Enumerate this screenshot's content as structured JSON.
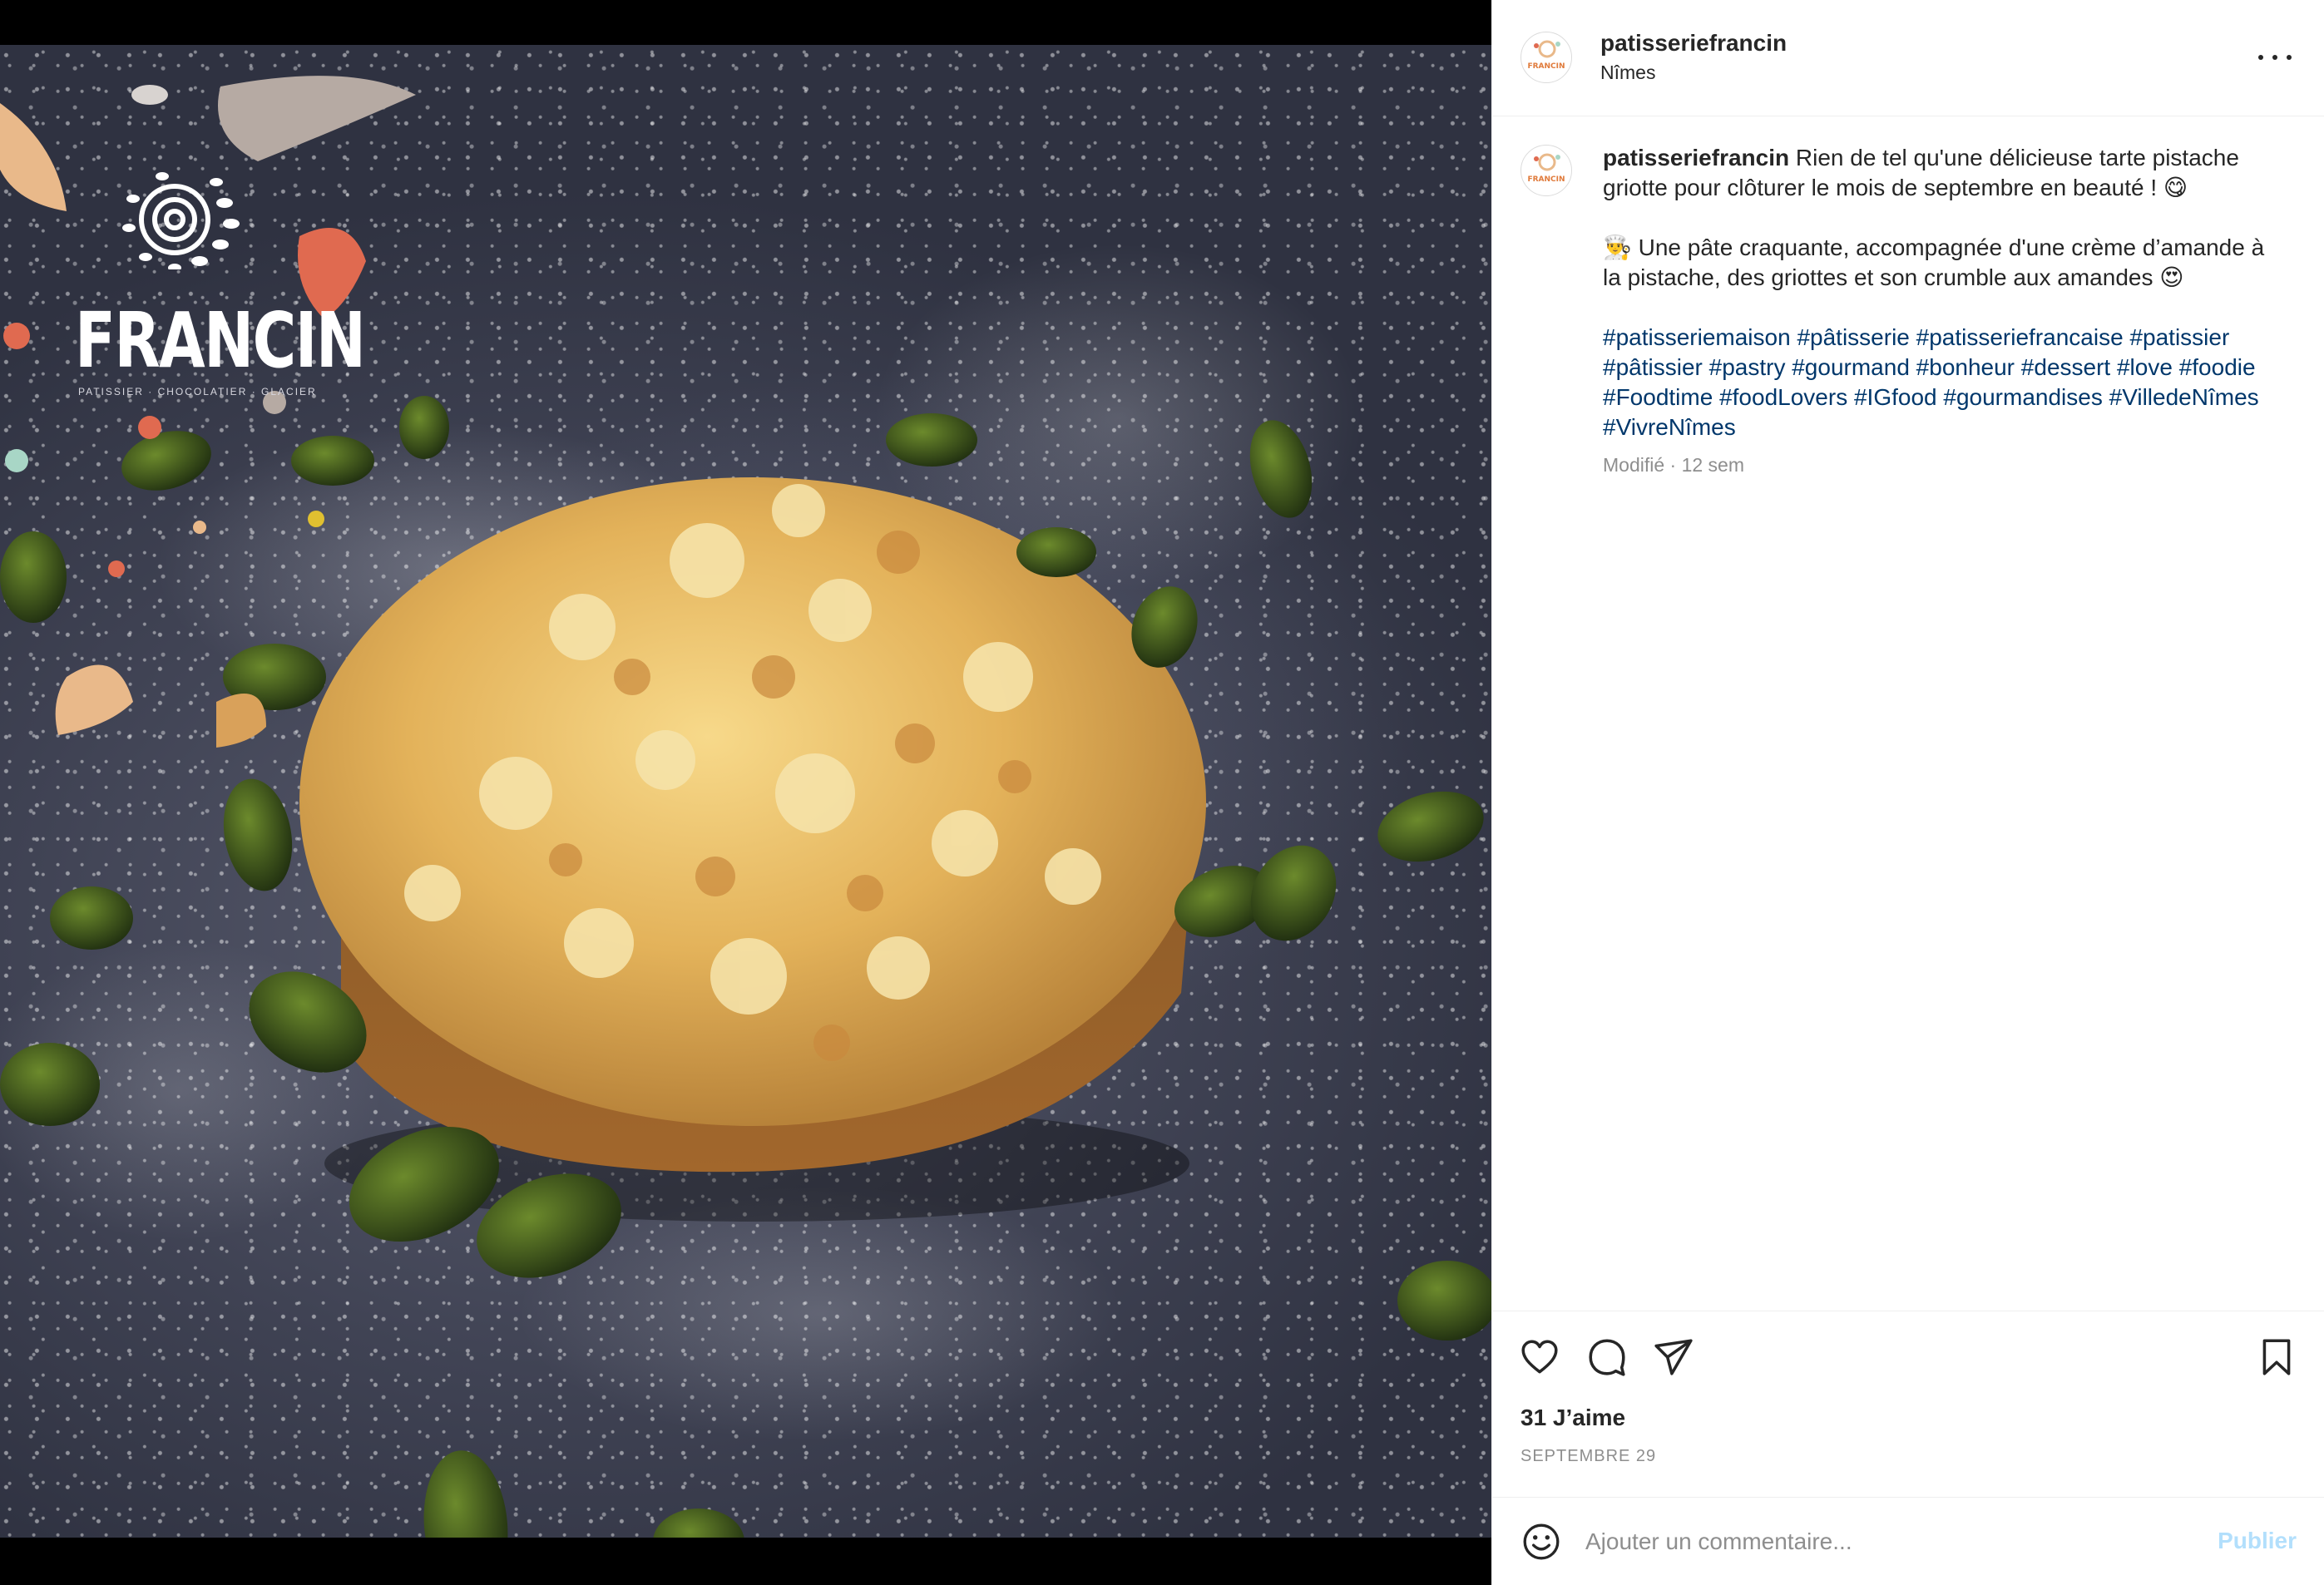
{
  "post": {
    "username": "patisseriefrancin",
    "location": "Nîmes",
    "avatar_text": "FRANCIN",
    "image": {
      "logo_word": "FRANCIN",
      "logo_subtitle": "PATISSIER · CHOCOLATIER · GLACIER",
      "alt": "Tarte pistache griotte avec crumble"
    }
  },
  "caption": {
    "username": "patisseriefrancin",
    "line1": "Rien de tel qu'une délicieuse tarte pistache griotte pour clôturer le mois de septembre en beauté ! 😋",
    "line2": "👨‍🍳 Une pâte craquante, accompagnée d'une crème d’amande à la pistache, des griottes et son crumble aux amandes 😍",
    "hashtags": [
      "#patisseriemaison",
      "#pâtisserie",
      "#patisseriefrancaise",
      "#patissier",
      "#pâtissier",
      "#pastry",
      "#gourmand",
      "#bonheur",
      "#dessert",
      "#love",
      "#foodie",
      "#Foodtime",
      "#foodLovers",
      "#IGfood",
      "#gourmandises",
      "#VilledeNîmes",
      "#VivreNîmes"
    ],
    "edited": "Modifié · 12 sem"
  },
  "actions": {
    "icons": [
      "heart-icon",
      "comment-icon",
      "share-icon",
      "bookmark-icon"
    ],
    "likes": "31 J’aime",
    "date": "SEPTEMBRE 29"
  },
  "comment": {
    "placeholder": "Ajouter un commentaire...",
    "publish_label": "Publier"
  },
  "colors": {
    "hashtag": "#00376b",
    "publish_disabled": "#b2dffc",
    "muted": "#8e8e8e"
  }
}
